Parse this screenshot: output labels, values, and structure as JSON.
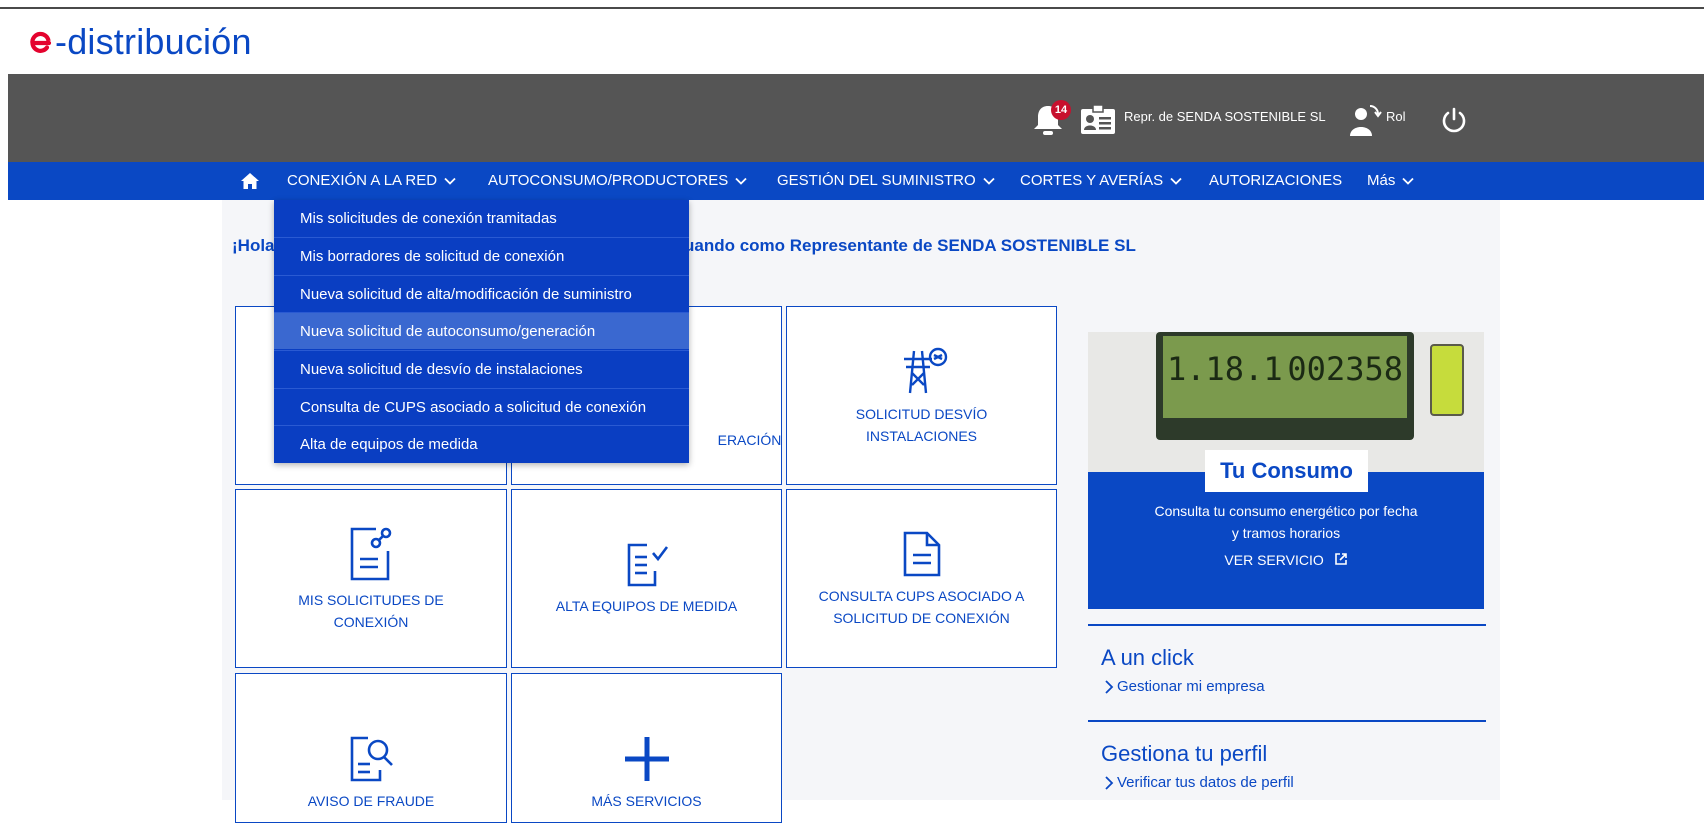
{
  "brand": {
    "name": "-distribución",
    "accent": "#e4032e",
    "primary": "#0a48c4"
  },
  "topbar": {
    "notifications_count": "14",
    "representative": "Repr. de SENDA SOSTENIBLE SL",
    "role": "Rol"
  },
  "nav": {
    "items": [
      "CONEXIÓN A LA RED",
      "AUTOCONSUMO/PRODUCTORES",
      "GESTIÓN DEL SUMINISTRO",
      "CORTES Y AVERÍAS",
      "AUTORIZACIONES",
      "Más"
    ]
  },
  "dropdown": {
    "items": [
      "Mis solicitudes de conexión tramitadas",
      "Mis borradores de solicitud de conexión",
      "Nueva solicitud de alta/modificación de suministro",
      "Nueva solicitud de autoconsumo/generación",
      "Nueva solicitud de desvío de instalaciones",
      "Consulta de CUPS asociado a solicitud de conexión",
      "Alta de equipos de medida"
    ],
    "highlighted_index": 3
  },
  "greeting": {
    "start": "¡Hola",
    "end": "uando como Representante de SENDA SOSTENIBLE SL"
  },
  "tiles": {
    "t1_partial": "ERACIÓN",
    "t2": [
      "SOLICITUD DESVÍO",
      "INSTALACIONES"
    ],
    "t3": [
      "MIS SOLICITUDES DE",
      "CONEXIÓN"
    ],
    "t4": [
      "ALTA EQUIPOS DE MEDIDA"
    ],
    "t5": [
      "CONSULTA CUPS ASOCIADO A",
      "SOLICITUD DE CONEXIÓN"
    ],
    "t6": [
      "AVISO DE FRAUDE"
    ],
    "t7": [
      "MÁS SERVICIOS"
    ]
  },
  "promo": {
    "meter_left": "1.18.1",
    "meter_right": "002358",
    "title": "Tu Consumo",
    "desc1": "Consulta tu consumo energético por fecha",
    "desc2": "y tramos horarios",
    "link": "VER SERVICIO"
  },
  "sidebar": {
    "s1_title": "A un click",
    "s1_link": "Gestionar mi empresa",
    "s2_title": "Gestiona tu perfil",
    "s2_link": "Verificar tus datos de perfil"
  }
}
